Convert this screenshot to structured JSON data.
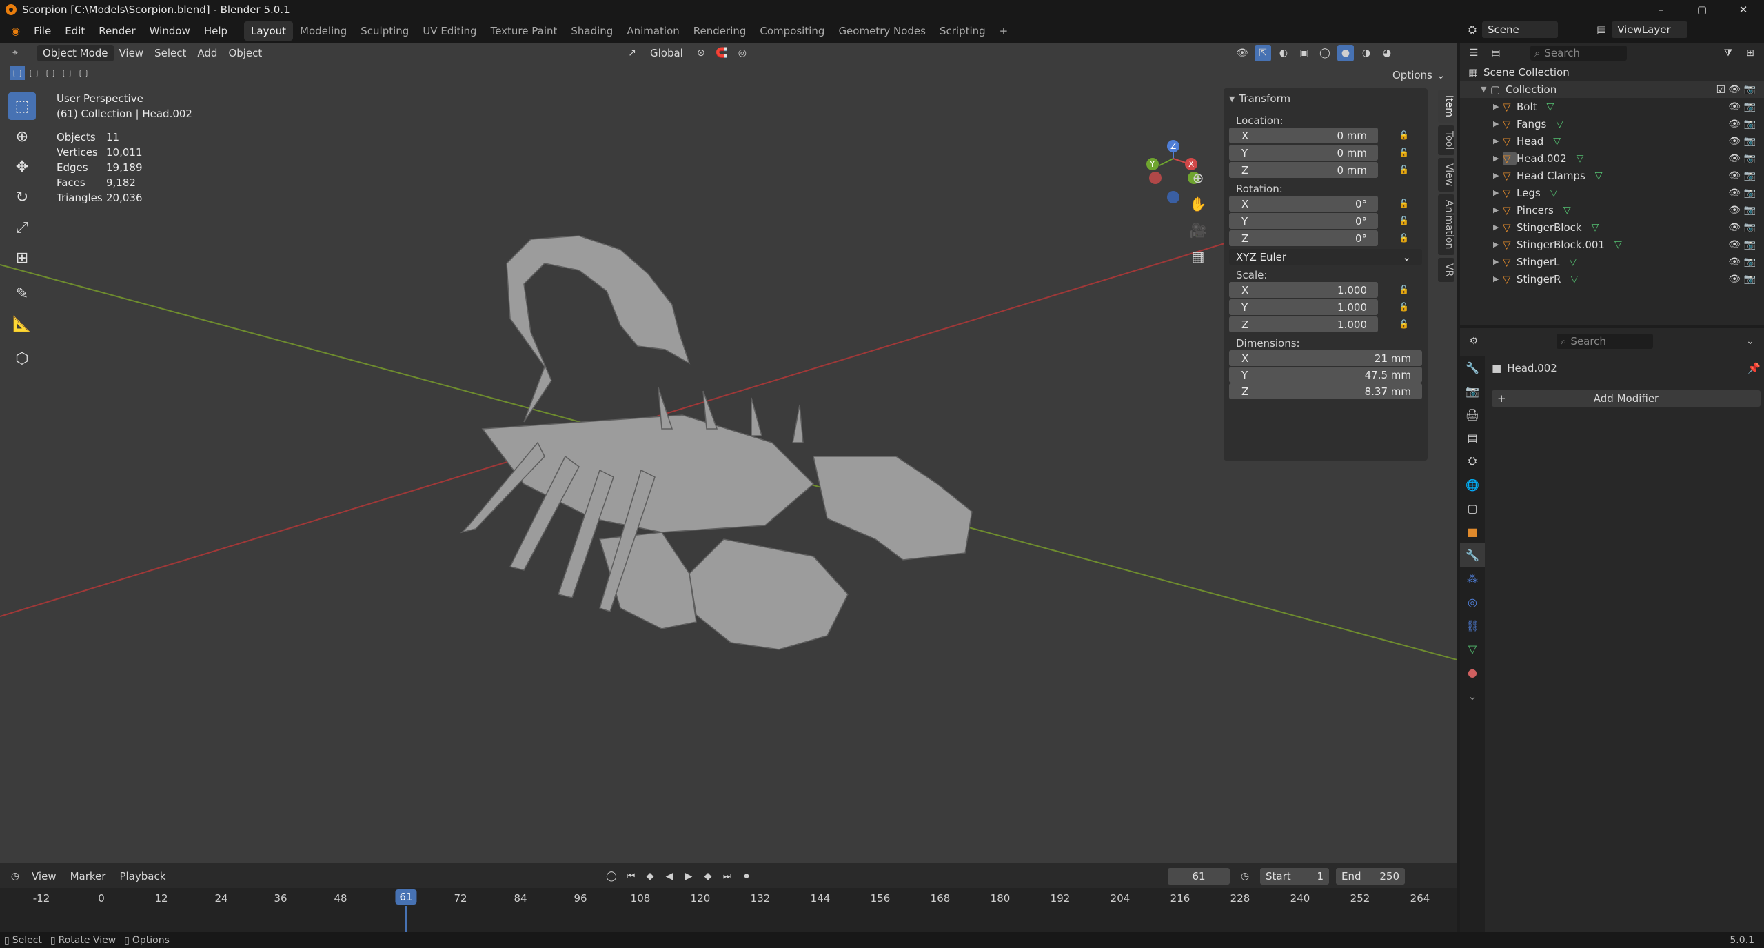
{
  "window": {
    "title": "Scorpion [C:\\Models\\Scorpion.blend] - Blender 5.0.1",
    "controls": [
      "–",
      "▢",
      "✕"
    ]
  },
  "menubar": {
    "menus": [
      "File",
      "Edit",
      "Render",
      "Window",
      "Help"
    ],
    "workspaces": [
      "Layout",
      "Modeling",
      "Sculpting",
      "UV Editing",
      "Texture Paint",
      "Shading",
      "Animation",
      "Rendering",
      "Compositing",
      "Geometry Nodes",
      "Scripting"
    ],
    "active_workspace": "Layout",
    "add_tab": "+"
  },
  "viewport": {
    "mode": "Object Mode",
    "menus": [
      "View",
      "Select",
      "Add",
      "Object"
    ],
    "orientation": "Global",
    "options_label": "Options",
    "info": {
      "perspective": "User Perspective",
      "context": "(61) Collection | Head.002"
    },
    "stats": [
      {
        "label": "Objects",
        "value": "11"
      },
      {
        "label": "Vertices",
        "value": "10,011"
      },
      {
        "label": "Edges",
        "value": "19,189"
      },
      {
        "label": "Faces",
        "value": "9,182"
      },
      {
        "label": "Triangles",
        "value": "20,036"
      }
    ],
    "gizmo_labels": {
      "z": "Z",
      "y": "Y",
      "x": "X"
    }
  },
  "transform_panel": {
    "title": "Transform",
    "location_label": "Location:",
    "location": [
      {
        "axis": "X",
        "value": "0 mm"
      },
      {
        "axis": "Y",
        "value": "0 mm"
      },
      {
        "axis": "Z",
        "value": "0 mm"
      }
    ],
    "rotation_label": "Rotation:",
    "rotation": [
      {
        "axis": "X",
        "value": "0°"
      },
      {
        "axis": "Y",
        "value": "0°"
      },
      {
        "axis": "Z",
        "value": "0°"
      }
    ],
    "rotation_mode": "XYZ Euler",
    "scale_label": "Scale:",
    "scale": [
      {
        "axis": "X",
        "value": "1.000"
      },
      {
        "axis": "Y",
        "value": "1.000"
      },
      {
        "axis": "Z",
        "value": "1.000"
      }
    ],
    "dimensions_label": "Dimensions:",
    "dimensions": [
      {
        "axis": "X",
        "value": "21 mm"
      },
      {
        "axis": "Y",
        "value": "47.5 mm"
      },
      {
        "axis": "Z",
        "value": "8.37 mm"
      }
    ],
    "side_tabs": [
      "Item",
      "Tool",
      "View",
      "Animation",
      "VR"
    ]
  },
  "outliner": {
    "scene": "Scene",
    "view_layer": "ViewLayer",
    "search_placeholder": "Search",
    "root": "Scene Collection",
    "collection": "Collection",
    "objects": [
      "Bolt",
      "Fangs",
      "Head",
      "Head.002",
      "Head Clamps",
      "Legs",
      "Pincers",
      "StingerBlock",
      "StingerBlock.001",
      "StingerL",
      "StingerR"
    ],
    "selected": "Head.002"
  },
  "properties": {
    "search_placeholder": "Search",
    "object_name": "Head.002",
    "add_modifier": "Add Modifier"
  },
  "timeline": {
    "menus": [
      "View",
      "Marker",
      "Playback"
    ],
    "current_frame": "61",
    "start_label": "Start",
    "start": "1",
    "end_label": "End",
    "end": "250",
    "ticks": [
      "-12",
      "0",
      "12",
      "24",
      "36",
      "48",
      "61",
      "72",
      "84",
      "96",
      "108",
      "120",
      "132",
      "144",
      "156",
      "168",
      "180",
      "192",
      "204",
      "216",
      "228",
      "240",
      "252",
      "264"
    ]
  },
  "statusbar": {
    "items": [
      "Select",
      "Rotate View",
      "Options"
    ],
    "version": "5.0.1"
  },
  "colors": {
    "accent": "#4772b3",
    "viewport_bg": "#3c3c3c",
    "panel_bg": "#282828",
    "x_axis": "#a03838",
    "y_axis": "#6e8c2e"
  }
}
